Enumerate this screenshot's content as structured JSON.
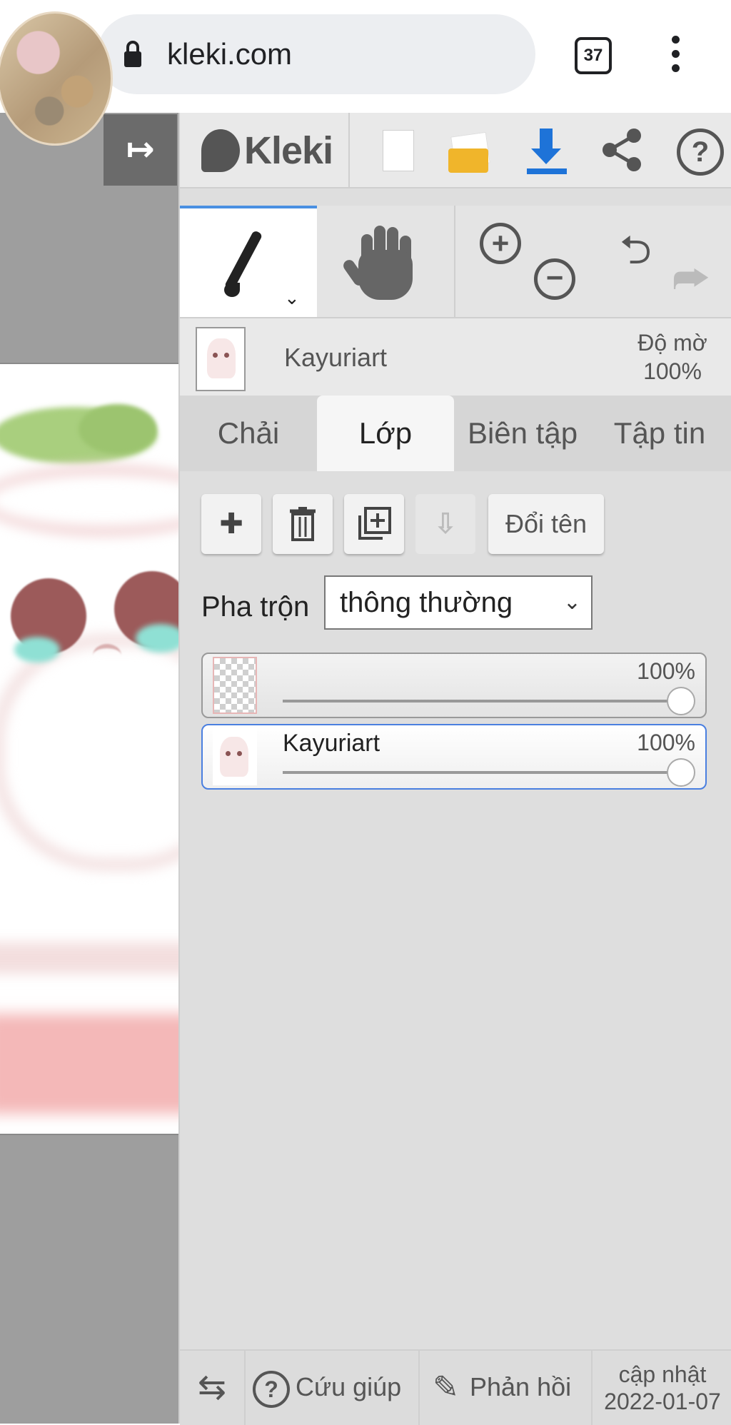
{
  "browser": {
    "url": "kleki.com",
    "tab_count": "37"
  },
  "app": {
    "logo_text": "Kleki"
  },
  "layer_info": {
    "name": "Kayuriart",
    "opacity_label": "Độ mờ",
    "opacity_value": "100%"
  },
  "tabs": [
    {
      "label": "Chải"
    },
    {
      "label": "Lớp"
    },
    {
      "label": "Biên tập"
    },
    {
      "label": "Tập tin"
    }
  ],
  "layer_buttons": {
    "rename": "Đổi tên"
  },
  "blend": {
    "label": "Pha trộn",
    "value": "thông thường"
  },
  "layers": [
    {
      "name": "",
      "opacity": "100%",
      "opacity_fraction": 1.0
    },
    {
      "name": "Kayuriart",
      "opacity": "100%",
      "opacity_fraction": 1.0
    }
  ],
  "footer": {
    "help": "Cứu giúp",
    "feedback": "Phản hồi",
    "update_label": "cập nhật",
    "update_date": "2022-01-07"
  },
  "colors": {
    "accent": "#4a90e2",
    "download": "#1e73d8",
    "folder": "#f0b52b",
    "panel_bg": "#dedede"
  },
  "icons": [
    "lock-icon",
    "menu-icon",
    "collapse-icon",
    "new-file-icon",
    "open-folder-icon",
    "download-icon",
    "share-icon",
    "help-icon",
    "brush-icon",
    "hand-icon",
    "zoom-in-icon",
    "zoom-out-icon",
    "undo-icon",
    "redo-icon",
    "add-layer-icon",
    "delete-layer-icon",
    "duplicate-layer-icon",
    "merge-down-icon",
    "swap-icon",
    "feedback-icon"
  ]
}
